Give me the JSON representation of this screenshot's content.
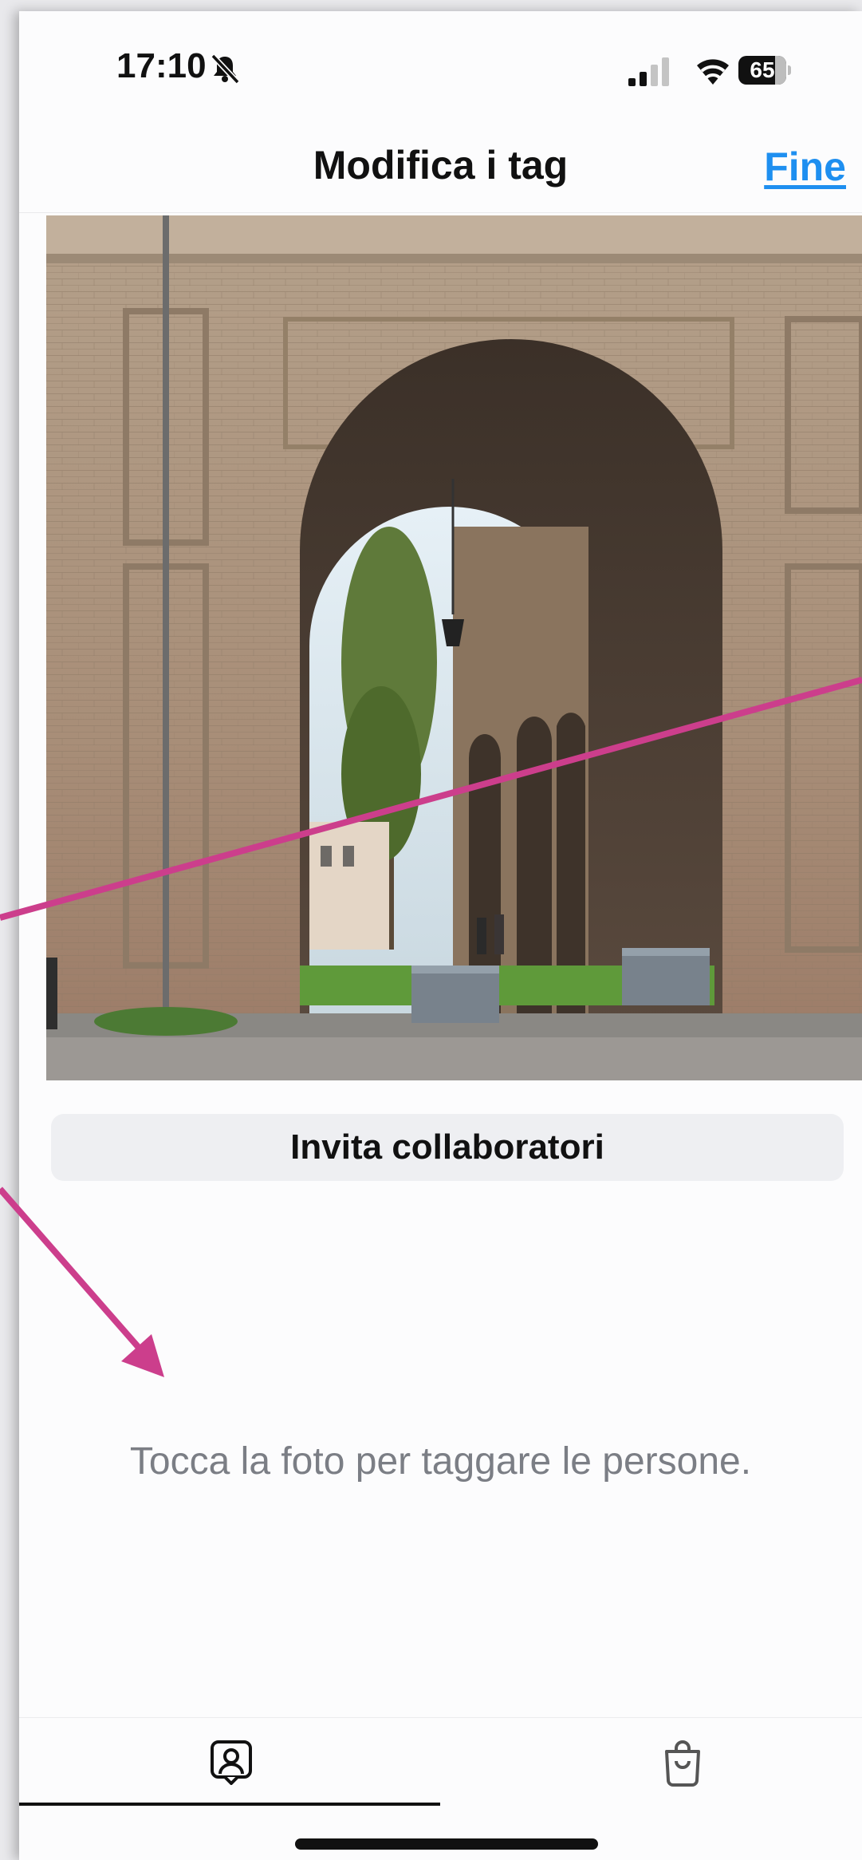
{
  "status_bar": {
    "time": "17:10",
    "battery_level": "65",
    "icons": [
      "bell-slash-icon",
      "cellular-signal-icon",
      "wifi-icon",
      "battery-icon"
    ]
  },
  "nav": {
    "title": "Modifica i tag",
    "done_label": "Fine"
  },
  "photo": {
    "description_icon": "photo-arcade-brick-building"
  },
  "invite_button": {
    "label": "Invita collaboratori"
  },
  "hint": {
    "text": "Tocca la foto per taggare le persone."
  },
  "tabs": [
    {
      "icon": "tag-person-icon",
      "selected": true
    },
    {
      "icon": "shopping-bag-icon",
      "selected": false
    }
  ],
  "colors": {
    "accent": "#1e8ff0",
    "annotation": "#cc3e8c",
    "hint": "#7b7e85"
  }
}
